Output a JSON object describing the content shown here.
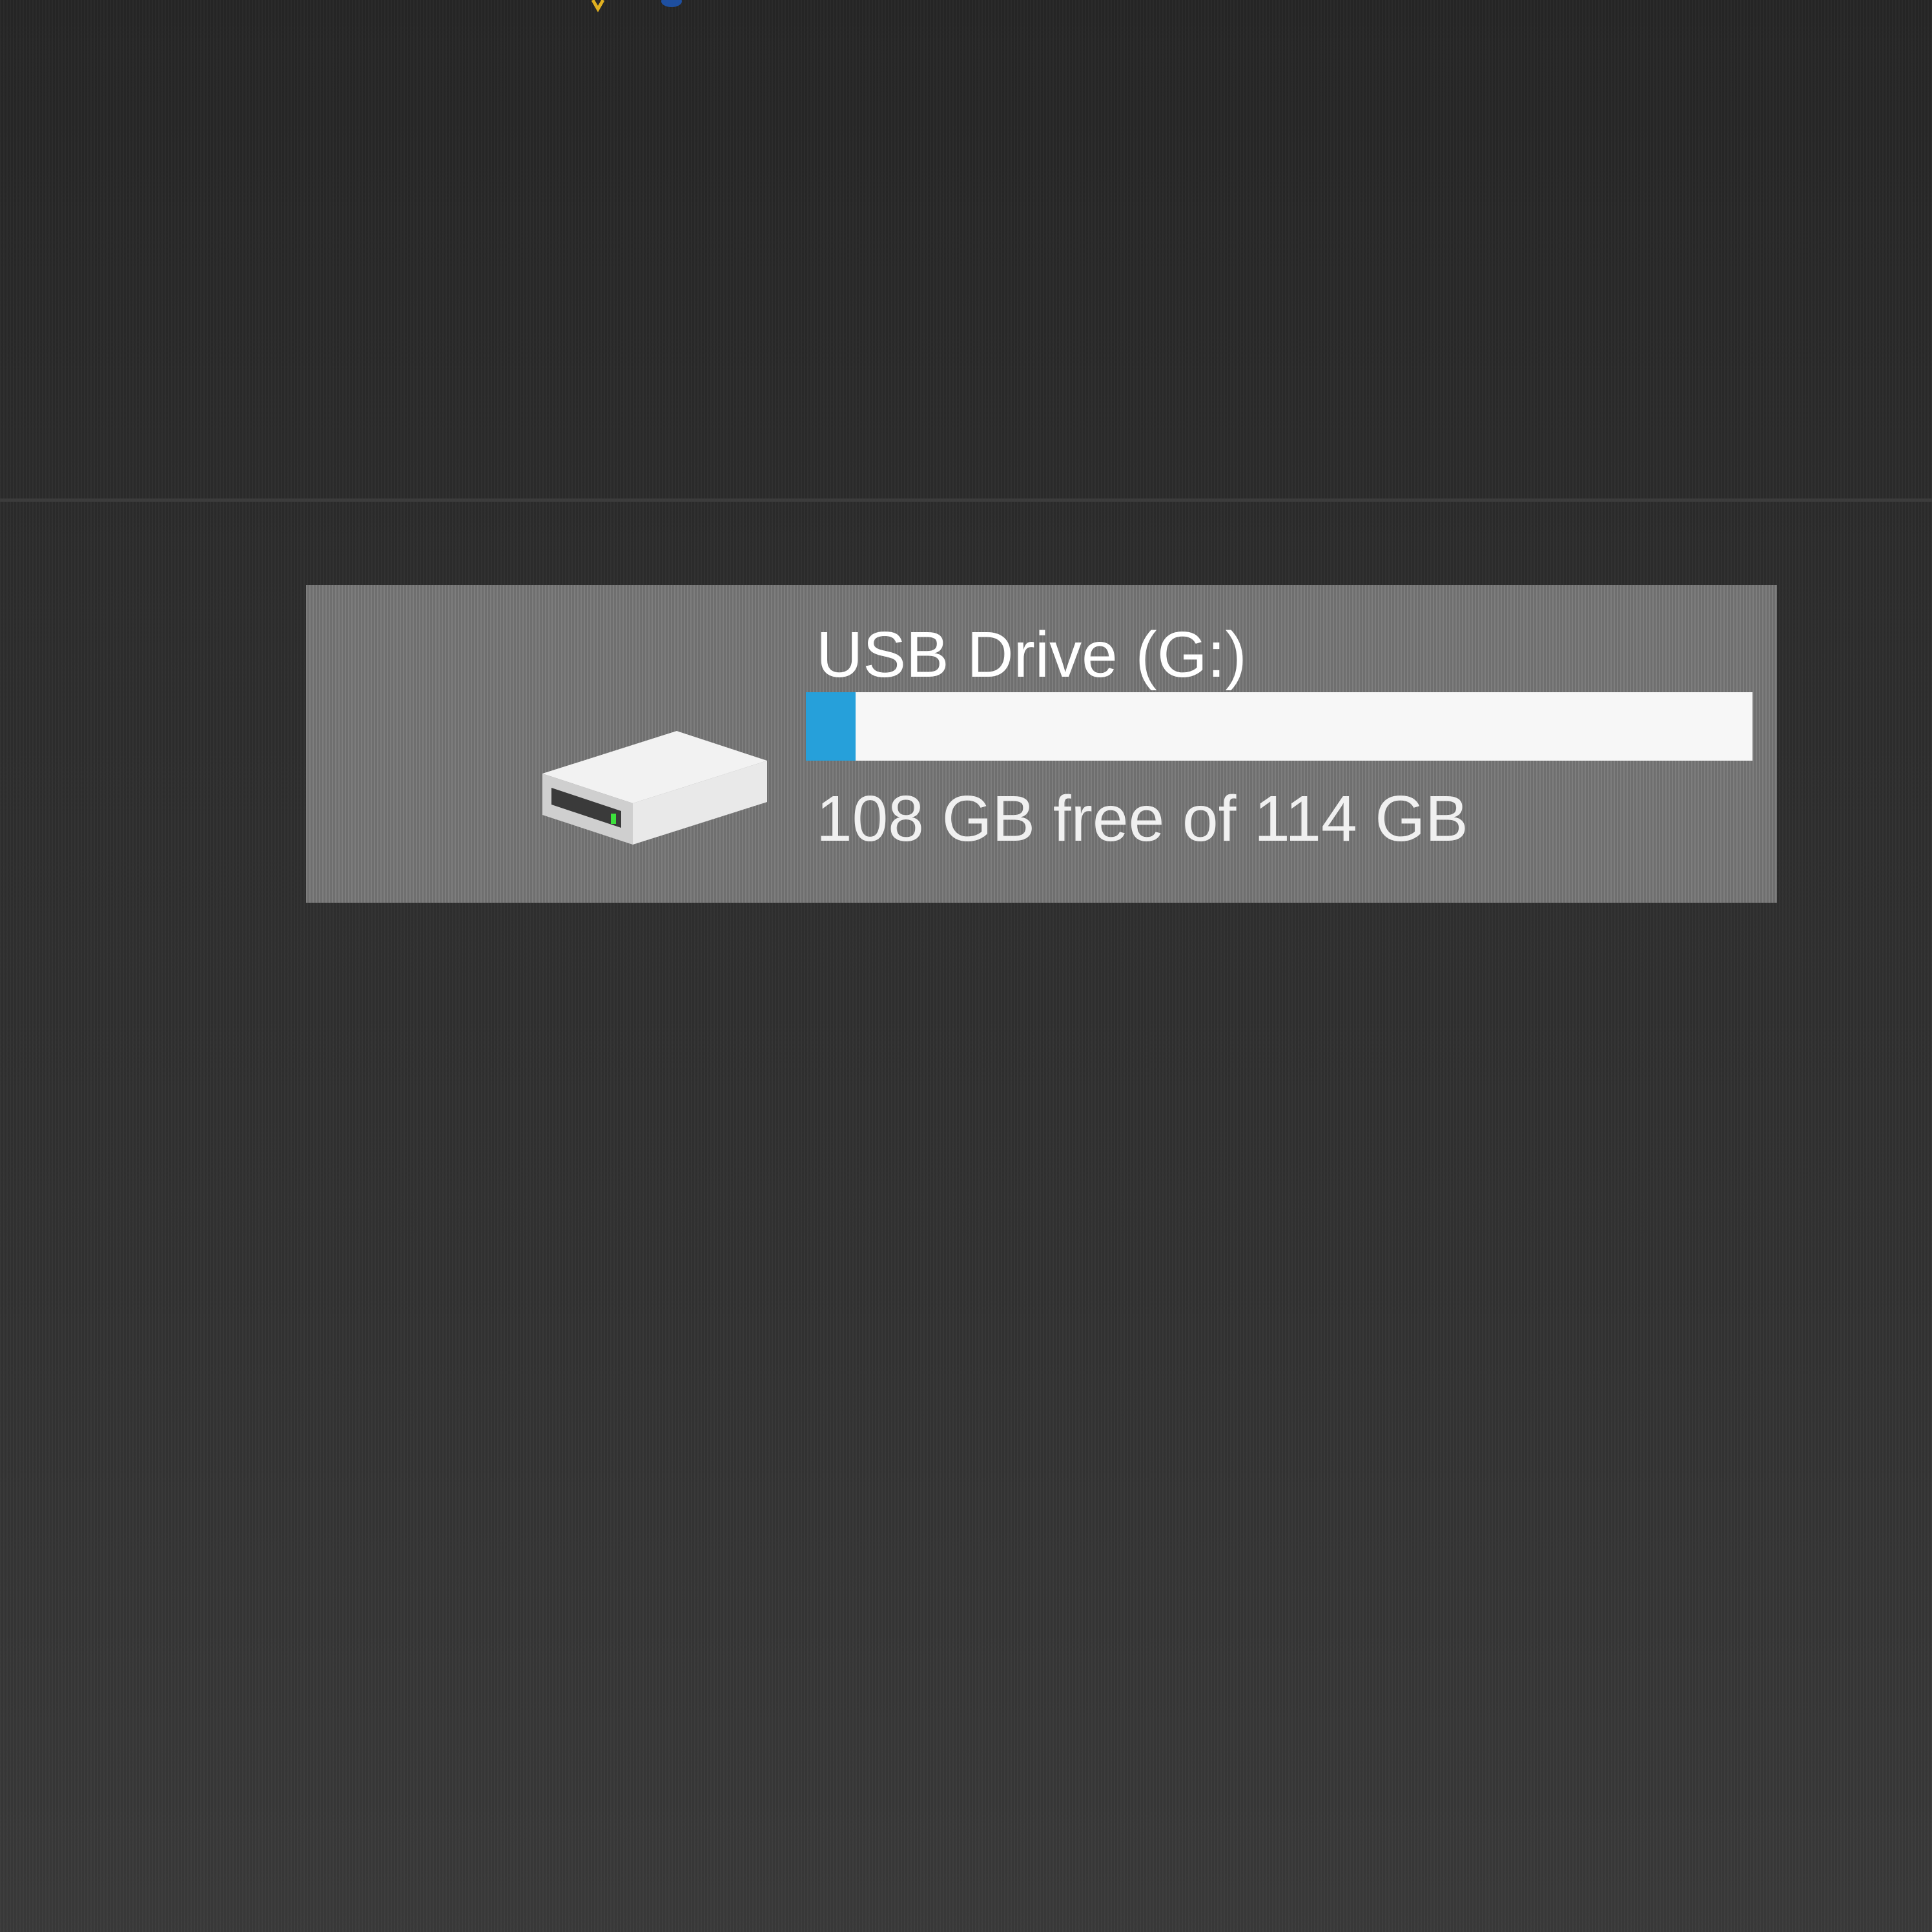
{
  "drive": {
    "name": "USB Drive (G:)",
    "free_space_text": "108 GB free of 114 GB",
    "used_fraction": 0.0526,
    "icon": "usb-drive-icon"
  },
  "colors": {
    "background": "#2d2d2d",
    "tile": "#767676",
    "bar_track": "#f7f7f7",
    "bar_fill": "#26a0da",
    "text": "#ffffff"
  }
}
